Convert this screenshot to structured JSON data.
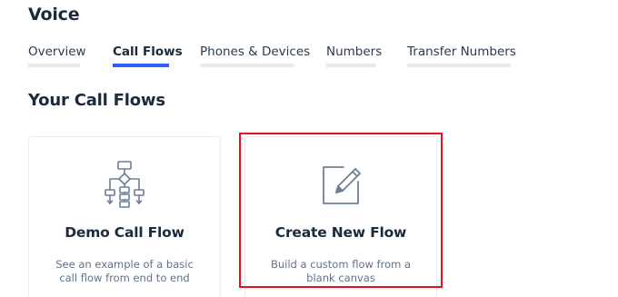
{
  "header": {
    "title": "Voice"
  },
  "tabs": [
    {
      "label": "Overview",
      "active": false
    },
    {
      "label": "Call Flows",
      "active": true
    },
    {
      "label": "Phones & Devices",
      "active": false
    },
    {
      "label": "Numbers",
      "active": false
    },
    {
      "label": "Transfer Numbers",
      "active": false
    }
  ],
  "section": {
    "title": "Your Call Flows"
  },
  "cards": [
    {
      "icon": "flowchart-icon",
      "title": "Demo Call Flow",
      "description": "See an example of a basic call flow from end to end"
    },
    {
      "icon": "edit-icon",
      "title": "Create New Flow",
      "description": "Build a custom flow from a blank canvas",
      "highlighted": true
    }
  ],
  "colors": {
    "accent": "#2f5ef5",
    "highlight": "#e3121d",
    "icon": "#6c7f96",
    "heading": "#1b2a3d",
    "muted": "#627286"
  }
}
